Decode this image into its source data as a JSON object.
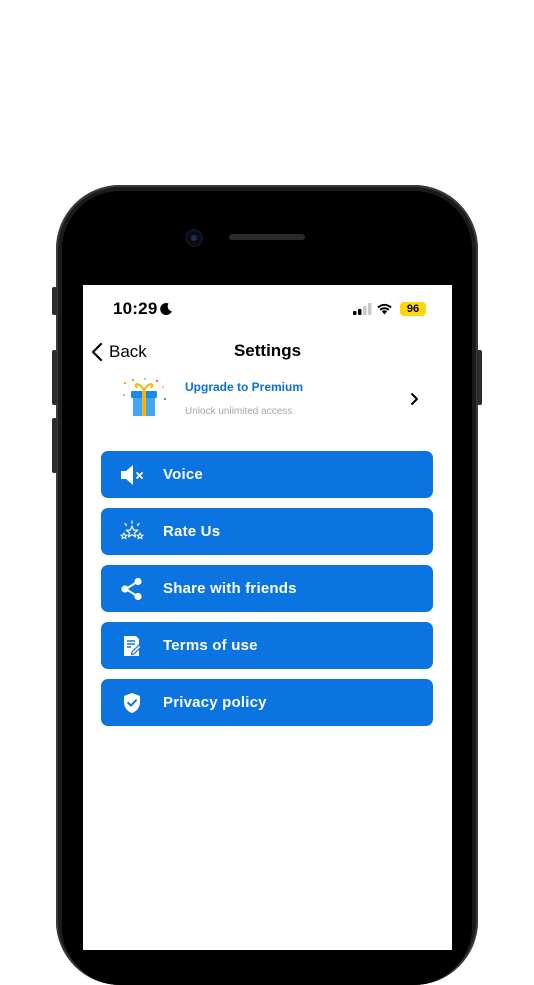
{
  "status_bar": {
    "time": "10:29",
    "battery": "96"
  },
  "nav": {
    "back_label": "Back",
    "title": "Settings"
  },
  "premium": {
    "title": "Upgrade to Premium",
    "subtitle": "Unlock unlimited access"
  },
  "menu": {
    "items": [
      {
        "label": "Voice",
        "icon": "speaker-muted-icon"
      },
      {
        "label": "Rate Us",
        "icon": "stars-icon"
      },
      {
        "label": "Share with friends",
        "icon": "share-icon"
      },
      {
        "label": "Terms of use",
        "icon": "document-edit-icon"
      },
      {
        "label": "Privacy policy",
        "icon": "shield-check-icon"
      }
    ]
  },
  "colors": {
    "accent": "#0c74e0",
    "premium_text": "#0a6fd8",
    "battery": "#ffd60a"
  }
}
